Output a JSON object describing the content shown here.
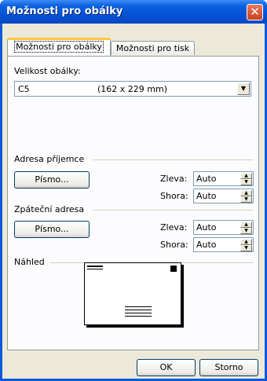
{
  "window": {
    "title": "Možnosti pro obálky",
    "close_glyph": "✕"
  },
  "tabs": [
    {
      "label": "Možnosti pro obálky",
      "active": true
    },
    {
      "label": "Možnosti pro tisk",
      "active": false
    }
  ],
  "envelope_size": {
    "label": "Velikost obálky:",
    "value_name": "C5",
    "value_dims": "(162 x 229 mm)"
  },
  "recipient": {
    "heading": "Adresa příjemce",
    "font_button": "Písmo...",
    "left_label": "Zleva:",
    "left_value": "Auto",
    "top_label": "Shora:",
    "top_value": "Auto"
  },
  "return": {
    "heading": "Zpáteční adresa",
    "font_button": "Písmo...",
    "left_label": "Zleva:",
    "left_value": "Auto",
    "top_label": "Shora:",
    "top_value": "Auto"
  },
  "preview": {
    "heading": "Náhled"
  },
  "buttons": {
    "ok": "OK",
    "cancel": "Storno"
  }
}
